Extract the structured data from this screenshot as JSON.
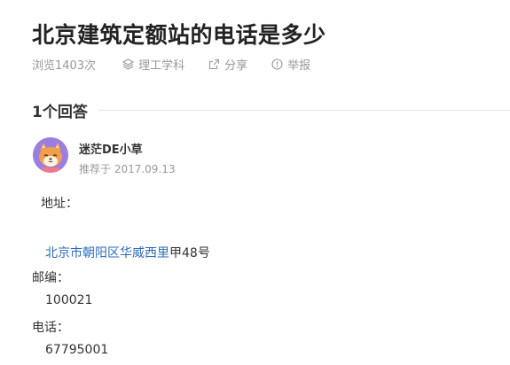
{
  "question": {
    "title": "北京建筑定额站的电话是多少",
    "views": "浏览1403次",
    "category": "理工学科",
    "share": "分享",
    "report": "举报"
  },
  "answers": {
    "count_label": "1个回答"
  },
  "answer": {
    "user_name": "迷茫DE小草",
    "recommended": "推荐于 2017.09.13",
    "address_label": "地址：",
    "address_link": "北京市朝阳区华威西里",
    "address_rest": "甲48号",
    "postcode_label": "邮编：",
    "postcode": "100021",
    "phone_label": "电话：",
    "phone": "67795001"
  },
  "colors": {
    "link": "#2e6bb8",
    "muted": "#999999",
    "avatar_bg": "#9a7ee0"
  },
  "icons": {
    "category": "layers-icon",
    "share": "share-icon",
    "report": "warning-circle-icon"
  }
}
